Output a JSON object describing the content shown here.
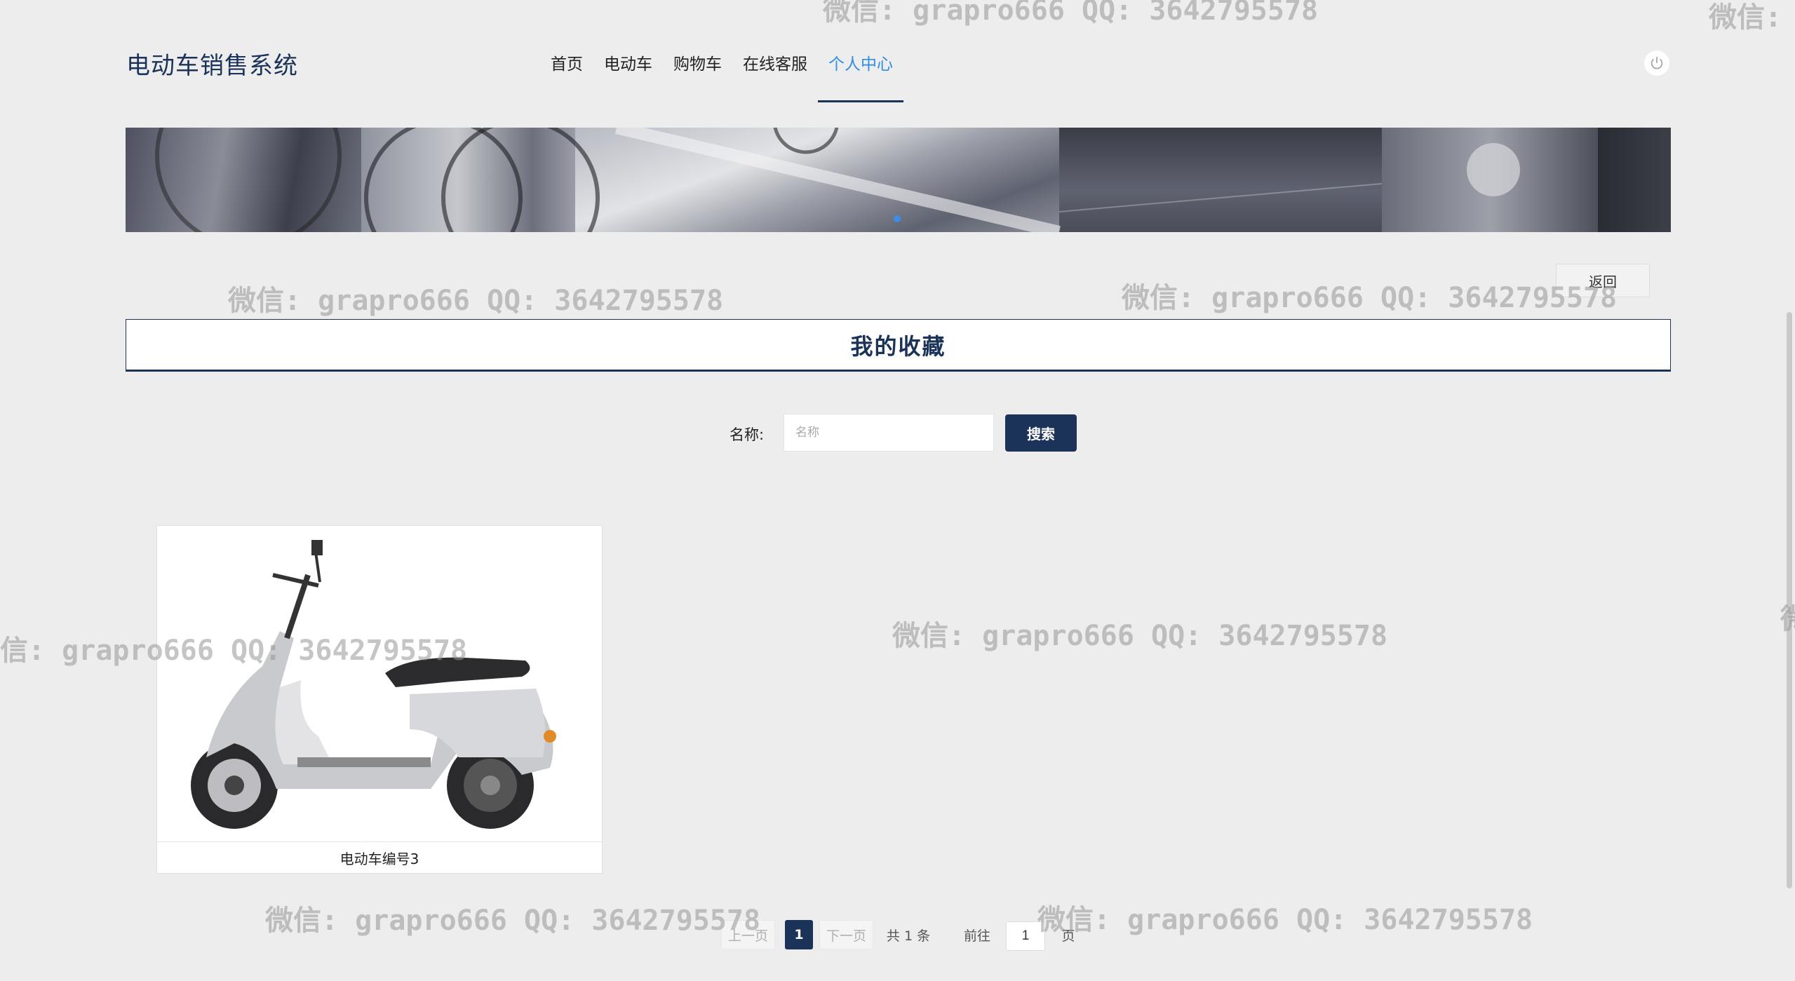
{
  "header": {
    "brand": "电动车销售系统",
    "nav": [
      "首页",
      "电动车",
      "购物车",
      "在线客服",
      "个人中心"
    ],
    "active_index": 4
  },
  "page": {
    "back_label": "返回",
    "title": "我的收藏"
  },
  "search": {
    "label": "名称:",
    "placeholder": "名称",
    "value": "",
    "button_label": "搜索"
  },
  "items": [
    {
      "caption": "电动车编号3",
      "icon": "scooter-image"
    }
  ],
  "pagination": {
    "prev_label": "上一页",
    "current": "1",
    "next_label": "下一页",
    "total": "共 1 条",
    "goto_label": "前往",
    "goto_value": "1",
    "page_suffix": "页"
  },
  "watermark": "微信: grapro666 QQ: 3642795578",
  "colors": {
    "primary": "#1b3358",
    "accent": "#2f8de4",
    "background": "#ededed"
  }
}
